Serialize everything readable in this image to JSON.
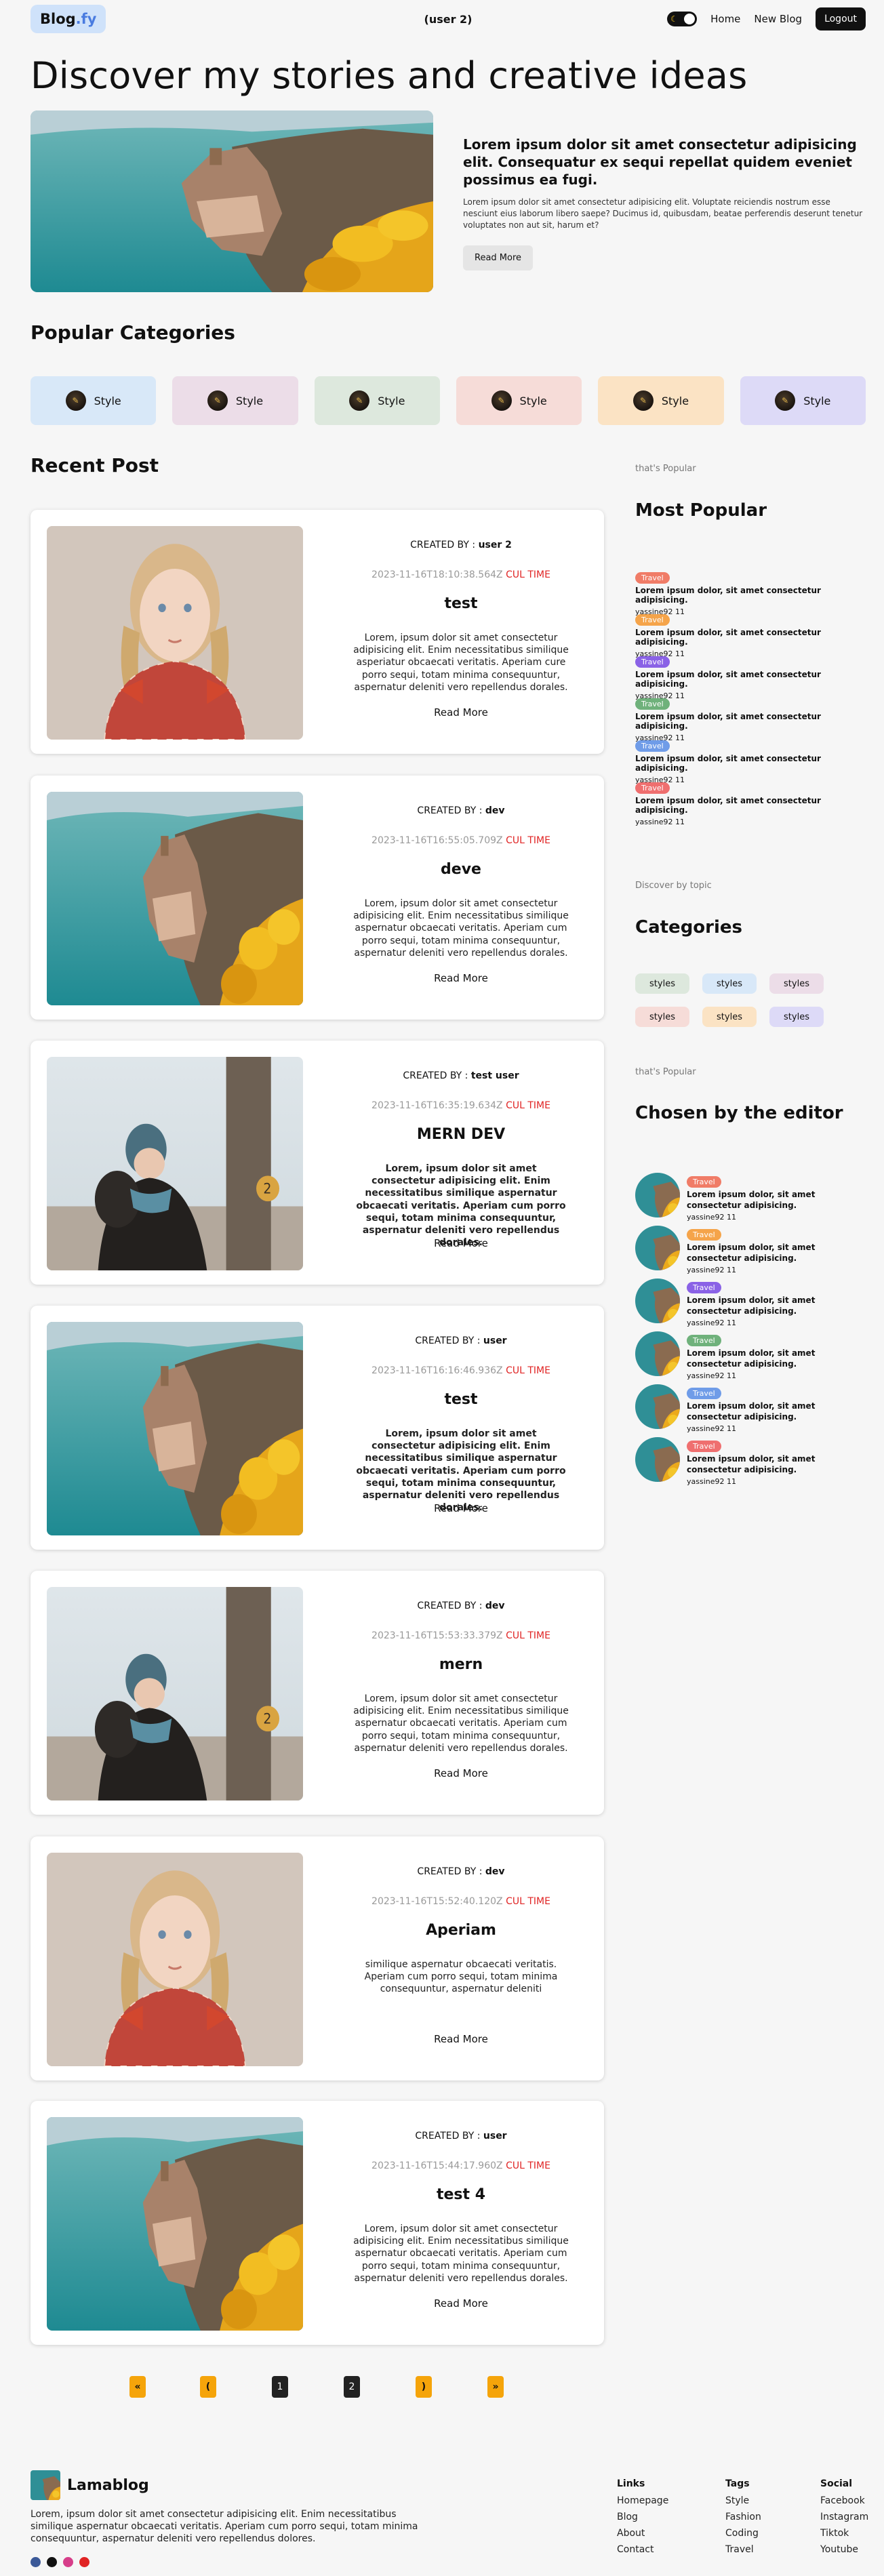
{
  "nav": {
    "logo_main": "Blog",
    "logo_accent": ".fy",
    "user": "(user 2)",
    "links": [
      "Home",
      "New Blog"
    ],
    "logout": "Logout",
    "moon_icon": "☾"
  },
  "hero": {
    "title": "Discover my stories and creative ideas",
    "heading": "Lorem ipsum dolor sit amet consectetur adipisicing elit. Consequatur ex sequi repellat quidem eveniet possimus ea fugi.",
    "text": "Lorem ipsum dolor sit amet consectetur adipisicing elit. Voluptate reiciendis nostrum esse nesciunt eius laborum libero saepe? Ducimus id, quibusdam, beatae perferendis deserunt tenetur voluptates non aut sit, harum et?",
    "button": "Read More"
  },
  "categories": {
    "title": "Popular Categories",
    "items": [
      {
        "label": "Style",
        "color": "#d8e8f8"
      },
      {
        "label": "Style",
        "color": "#ecdde8"
      },
      {
        "label": "Style",
        "color": "#dde8dd"
      },
      {
        "label": "Style",
        "color": "#f6dcd8"
      },
      {
        "label": "Style",
        "color": "#fbe3c4"
      },
      {
        "label": "Style",
        "color": "#dddaf7"
      }
    ]
  },
  "recent": {
    "title": "Recent Post",
    "by_prefix": "CREATED BY : ",
    "cul": "CUL TIME",
    "read_more": "Read More",
    "posts": [
      {
        "author": "user 2",
        "time": "2023-11-16T18:10:38.564Z",
        "title": "test",
        "desc": "Lorem, ipsum dolor sit amet consectetur adipisicing elit. Enim necessitatibus similique asperiatur obcaecati veritatis. Aperiam cure porro sequi, totam minima consequuntur, aspernatur deleniti vero repellendus dorales."
      },
      {
        "author": "dev",
        "time": "2023-11-16T16:55:05.709Z",
        "title": "deve",
        "desc": "Lorem, ipsum dolor sit amet consectetur adipisicing elit. Enim necessitatibus similique aspernatur obcaecati veritatis. Aperiam cum porro sequi, totam minima consequuntur, aspernatur deleniti vero repellendus dorales."
      },
      {
        "author": "test user",
        "time": "2023-11-16T16:35:19.634Z",
        "title": "MERN DEV",
        "desc": "Lorem, ipsum dolor sit amet consectetur adipisicing elit. Enim necessitatibus similique aspernatur obcaecati veritatis. Aperiam cum porro sequi, totam minima consequuntur, aspernatur deleniti vero repellendus dorales."
      },
      {
        "author": "user",
        "time": "2023-11-16T16:16:46.936Z",
        "title": "test",
        "desc": "Lorem, ipsum dolor sit amet consectetur adipisicing elit. Enim necessitatibus similique aspernatur obcaecati veritatis. Aperiam cum porro sequi, totam minima consequuntur, aspernatur deleniti vero repellendus dorales."
      },
      {
        "author": "dev",
        "time": "2023-11-16T15:53:33.379Z",
        "title": "mern",
        "desc": "Lorem, ipsum dolor sit amet consectetur adipisicing elit. Enim necessitatibus similique aspernatur obcaecati veritatis. Aperiam cum porro sequi, totam minima consequuntur, aspernatur deleniti vero repellendus dorales."
      },
      {
        "author": "dev",
        "time": "2023-11-16T15:52:40.120Z",
        "title": "Aperiam",
        "desc": "similique aspernatur obcaecati veritatis. Aperiam cum porro sequi, totam minima consequuntur, aspernatur deleniti"
      },
      {
        "author": "user",
        "time": "2023-11-16T15:44:17.960Z",
        "title": "test 4",
        "desc": "Lorem, ipsum dolor sit amet consectetur adipisicing elit. Enim necessitatibus similique aspernatur obcaecati veritatis. Aperiam cum porro sequi, totam minima consequuntur, aspernatur deleniti vero repellendus dorales."
      }
    ]
  },
  "popular": {
    "kicker": "that's Popular",
    "title": "Most Popular",
    "items": [
      {
        "tag": "Travel",
        "color": "#f07c67",
        "title": "Lorem ipsum dolor, sit amet consectetur adipisicing.",
        "author": "yassine92 11"
      },
      {
        "tag": "Travel",
        "color": "#f5a44a",
        "title": "Lorem ipsum dolor, sit amet consectetur adipisicing.",
        "author": "yassine92 11"
      },
      {
        "tag": "Travel",
        "color": "#8a62e6",
        "title": "Lorem ipsum dolor, sit amet consectetur adipisicing.",
        "author": "yassine92 11"
      },
      {
        "tag": "Travel",
        "color": "#6fb17b",
        "title": "Lorem ipsum dolor, sit amet consectetur adipisicing.",
        "author": "yassine92 11"
      },
      {
        "tag": "Travel",
        "color": "#6f9ce8",
        "title": "Lorem ipsum dolor, sit amet consectetur adipisicing.",
        "author": "yassine92 11"
      },
      {
        "tag": "Travel",
        "color": "#ef6f6f",
        "title": "Lorem ipsum dolor, sit amet consectetur adipisicing.",
        "author": "yassine92 11"
      }
    ]
  },
  "topics": {
    "kicker": "Discover by topic",
    "title": "Categories",
    "chips": [
      {
        "label": "styles",
        "color": "#dde8dd"
      },
      {
        "label": "styles",
        "color": "#d8e8f8"
      },
      {
        "label": "styles",
        "color": "#ecdde8"
      },
      {
        "label": "styles",
        "color": "#f6dcd8"
      },
      {
        "label": "styles",
        "color": "#fbe3c4"
      },
      {
        "label": "styles",
        "color": "#dddaf7"
      }
    ]
  },
  "editor": {
    "kicker": "that's Popular",
    "title": "Chosen by the editor",
    "items": [
      {
        "tag": "Travel",
        "color": "#f07c67",
        "title": "Lorem ipsum dolor, sit amet consectetur adipisicing.",
        "author": "yassine92 11"
      },
      {
        "tag": "Travel",
        "color": "#f5a44a",
        "title": "Lorem ipsum dolor, sit amet consectetur adipisicing.",
        "author": "yassine92 11"
      },
      {
        "tag": "Travel",
        "color": "#8a62e6",
        "title": "Lorem ipsum dolor, sit amet consectetur adipisicing.",
        "author": "yassine92 11"
      },
      {
        "tag": "Travel",
        "color": "#6fb17b",
        "title": "Lorem ipsum dolor, sit amet consectetur adipisicing.",
        "author": "yassine92 11"
      },
      {
        "tag": "Travel",
        "color": "#6f9ce8",
        "title": "Lorem ipsum dolor, sit amet consectetur adipisicing.",
        "author": "yassine92 11"
      },
      {
        "tag": "Travel",
        "color": "#ef6f6f",
        "title": "Lorem ipsum dolor, sit amet consectetur adipisicing.",
        "author": "yassine92 11"
      }
    ]
  },
  "pagination": {
    "first": "«",
    "prev": "(",
    "pages": [
      "1",
      "2"
    ],
    "next": ")",
    "last": "»"
  },
  "footer": {
    "brand": "Lamablog",
    "desc": "Lorem, ipsum dolor sit amet consectetur adipisicing elit. Enim necessitatibus similique aspernatur obcaecati veritatis. Aperiam cum porro sequi, totam minima consequuntur, aspernatur deleniti vero repellendus dolores.",
    "social_icons": [
      {
        "name": "facebook-icon",
        "color": "#3b5998"
      },
      {
        "name": "tiktok-icon",
        "color": "#111111"
      },
      {
        "name": "instagram-icon",
        "color": "#d63e8a"
      },
      {
        "name": "youtube-icon",
        "color": "#e02424"
      }
    ],
    "cols": [
      {
        "heading": "Links",
        "items": [
          "Homepage",
          "Blog",
          "About",
          "Contact"
        ]
      },
      {
        "heading": "Tags",
        "items": [
          "Style",
          "Fashion",
          "Coding",
          "Travel"
        ]
      },
      {
        "heading": "Social",
        "items": [
          "Facebook",
          "Instagram",
          "Tiktok",
          "Youtube"
        ]
      }
    ]
  }
}
